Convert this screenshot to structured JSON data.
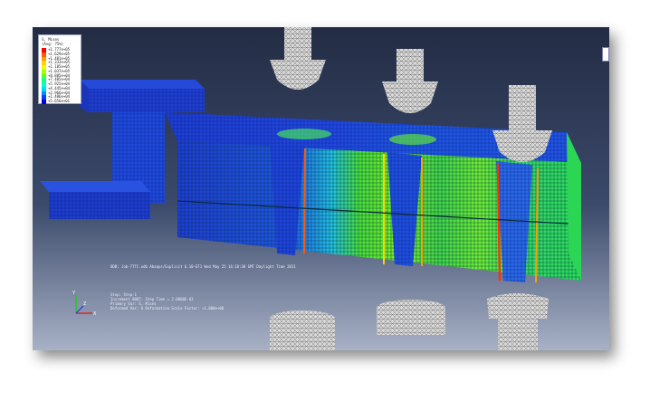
{
  "legend": {
    "title_line1": "S, Mises",
    "title_line2": "(Avg: 75%)",
    "ticks": [
      "+1.777e+05",
      "+1.629e+05",
      "+1.481e+05",
      "+1.333e+05",
      "+1.185e+05",
      "+1.037e+05",
      "+8.885e+04",
      "+7.405e+04",
      "+5.925e+04",
      "+4.445e+04",
      "+2.966e+04",
      "+1.486e+04",
      "+5.656e+01"
    ],
    "colors": [
      "#ff0000",
      "#ff5a00",
      "#ff9c00",
      "#ffd200",
      "#e8ff00",
      "#a6ff00",
      "#5cff1e",
      "#1cff7c",
      "#00ffc8",
      "#00d8ff",
      "#008cff",
      "#0040ff",
      "#0000e0"
    ]
  },
  "odb_line": "ODB: Job-77TC.odb    Abaqus/Explicit 6.10-EF1    Wed May 25 16:18:38 GMT Daylight Time 2011",
  "step_info": {
    "line1": "Step: Step-1",
    "line2": "Increment   8007: Step Time =    2.0000E-03",
    "line3": "Primary Var: S, Mises",
    "line4": "Deformed Var: U   Deformation Scale Factor: +1.000e+00"
  },
  "triad": {
    "x": "X",
    "y": "Y",
    "z": "Z"
  },
  "colors": {
    "background_top": "#232c44",
    "background_bottom": "#a8b1c6",
    "mesh_blue": "#1c3fd6",
    "mesh_green": "#44e02c",
    "mesh_cyan": "#1fc3e8"
  }
}
